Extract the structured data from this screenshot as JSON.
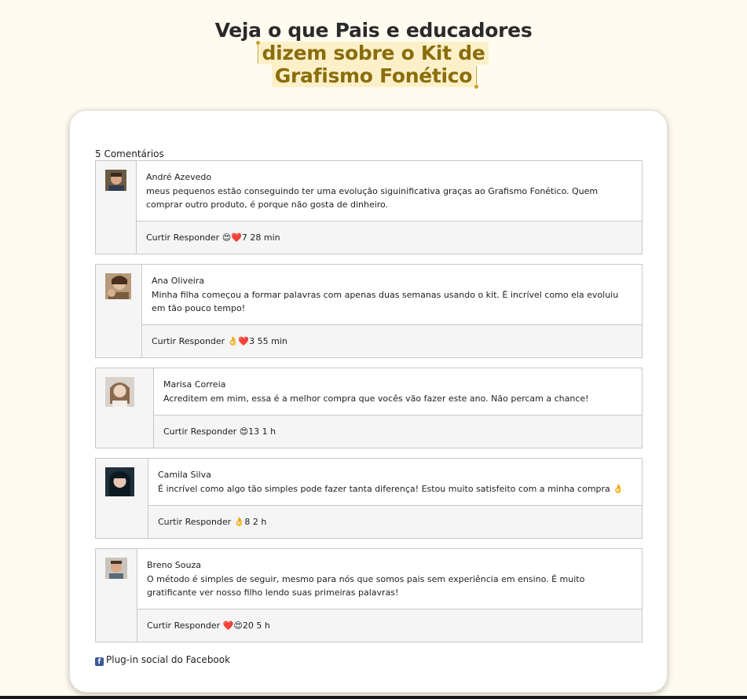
{
  "headline": {
    "line1": "Veja o que Pais e educadores",
    "line2": "dizem sobre o Kit de",
    "line3": "Grafismo Fonético"
  },
  "comments_header": {
    "count_label": "5 Comentários"
  },
  "comments": [
    {
      "author": "André Azevedo",
      "text": "meus pequenos estão conseguindo ter uma evolução siguinificativa graças ao Grafismo Fonético. Quem comprar outro produto, é porque não gosta de dinheiro.",
      "like_label": "Curtir",
      "reply_label": "Responder",
      "reactions": "😍❤️",
      "count": "7",
      "time": "28 min"
    },
    {
      "author": "Ana Oliveira",
      "text": "Minha filha começou a formar palavras com apenas duas semanas usando o kit. É incrível como ela evoluiu em tão pouco tempo!",
      "like_label": "Curtir",
      "reply_label": "Responder",
      "reactions": "👌❤️",
      "count": "3",
      "time": "55 min"
    },
    {
      "author": "Marisa Correia",
      "text": "Acreditem em mim, essa é a melhor compra que vocês vão fazer este ano. Não percam a chance!",
      "like_label": "Curtir",
      "reply_label": "Responder",
      "reactions": "😍",
      "count": "13",
      "time": "1 h"
    },
    {
      "author": "Camila Silva",
      "text": "É incrível como algo tão simples pode fazer tanta diferença! Estou muito satisfeito com a minha compra 👌",
      "like_label": "Curtir",
      "reply_label": "Responder",
      "reactions": "👌",
      "count": "8",
      "time": "2 h"
    },
    {
      "author": "Breno Souza",
      "text": "O método é simples de seguir, mesmo para nós que somos pais sem experiência em ensino. É muito gratificante ver nosso filho lendo suas primeiras palavras!",
      "like_label": "Curtir",
      "reply_label": "Responder",
      "reactions": "❤️😍",
      "count": "20",
      "time": "5 h"
    }
  ],
  "footer": {
    "plugin_label": "Plug-in social do Facebook",
    "icon": "facebook-icon"
  },
  "colors": {
    "background": "#fffbf0",
    "highlight_text": "#8a6d0c",
    "highlight_bg": "#fdf0c8"
  }
}
